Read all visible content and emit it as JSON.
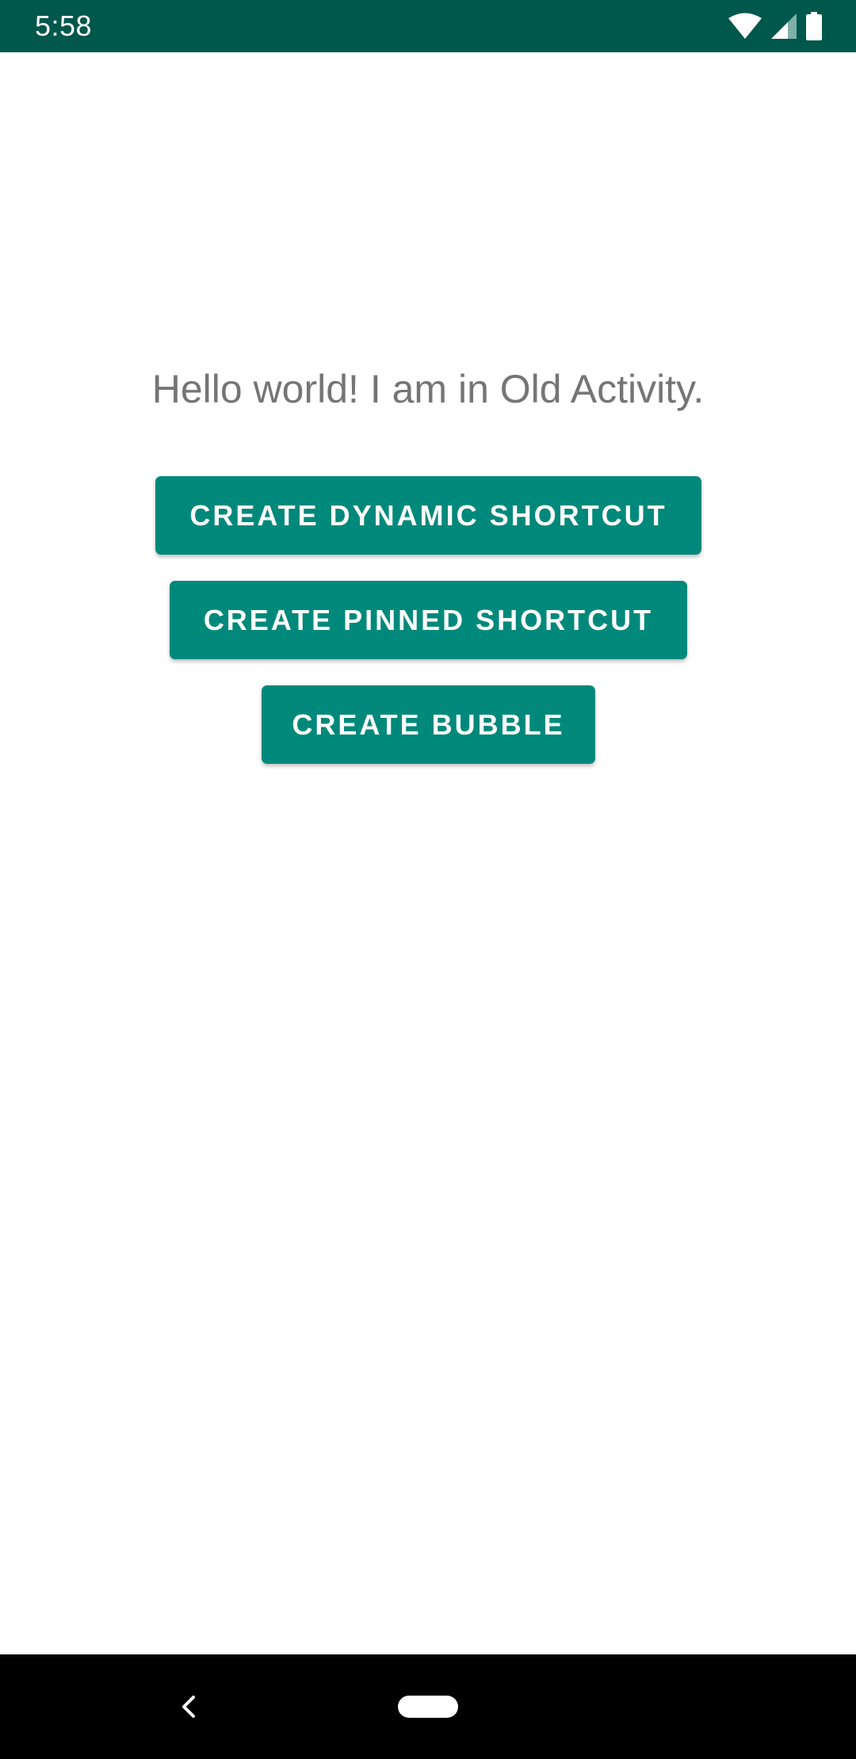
{
  "status_bar": {
    "time": "5:58",
    "background_color": "#00574b",
    "icons": [
      "wifi-icon",
      "cellular-signal-icon",
      "battery-icon"
    ]
  },
  "main": {
    "message": "Hello world! I am in Old Activity.",
    "buttons": {
      "dynamic_shortcut": "CREATE DYNAMIC SHORTCUT",
      "pinned_shortcut": "CREATE PINNED SHORTCUT",
      "bubble": "CREATE BUBBLE"
    },
    "button_color": "#00897b",
    "text_color": "#757575"
  },
  "nav_bar": {
    "icons": [
      "back-icon",
      "home-pill-icon"
    ]
  }
}
